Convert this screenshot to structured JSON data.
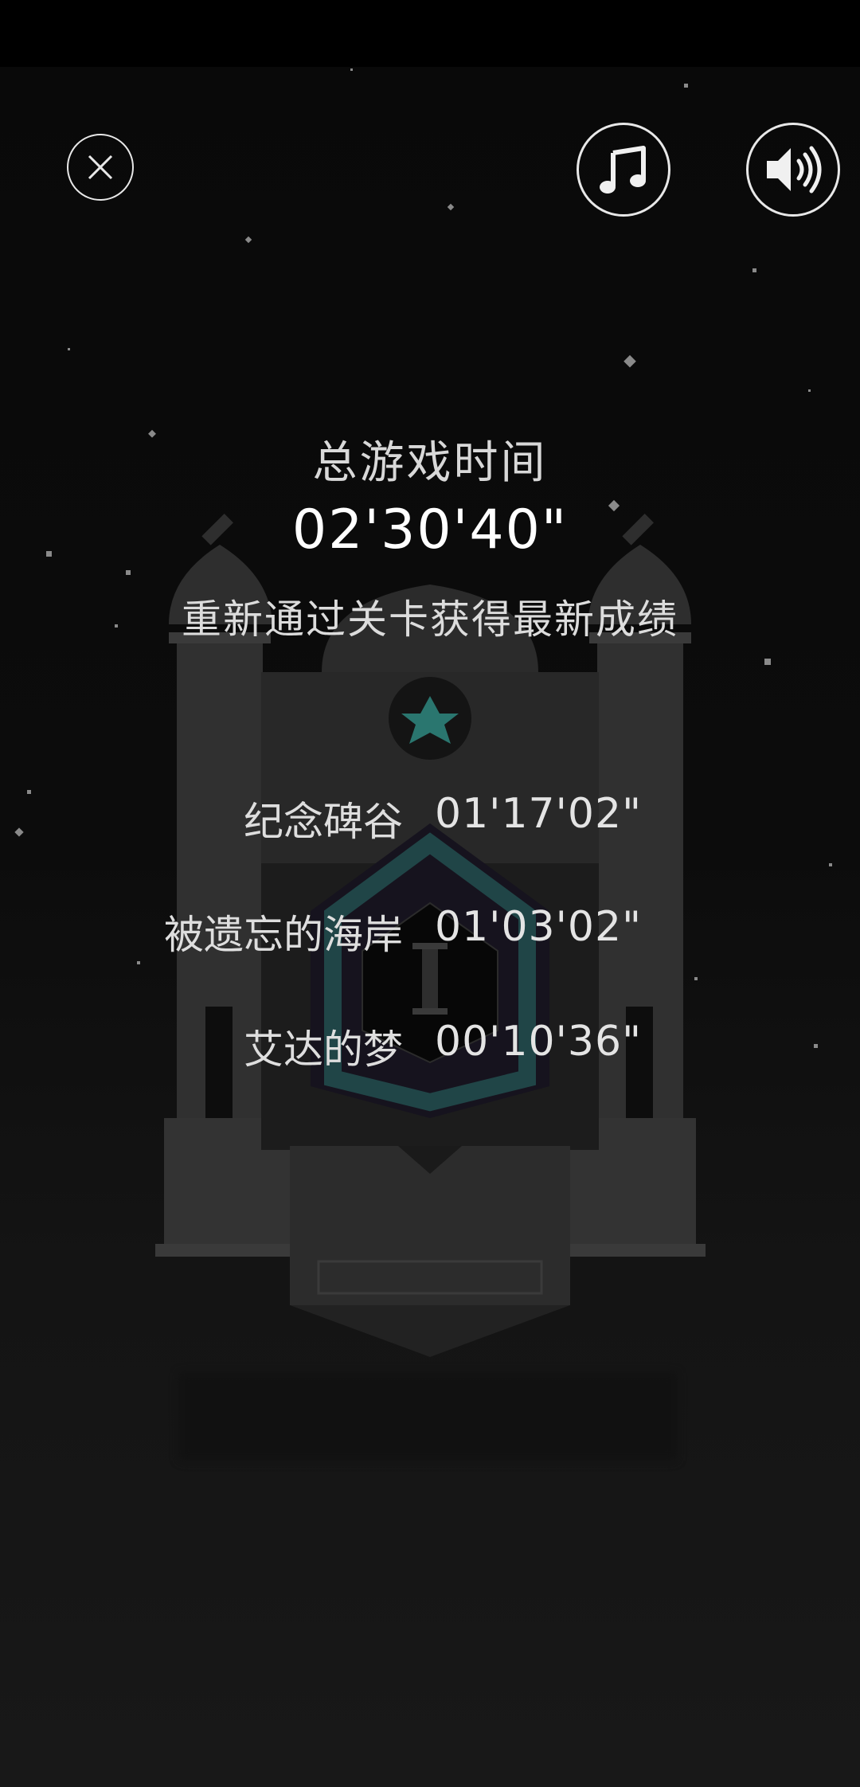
{
  "toolbar": {
    "close_icon": "close-icon",
    "music_icon": "music-note-icon",
    "sound_icon": "speaker-volume-icon"
  },
  "summary": {
    "total_label": "总游戏时间",
    "total_time": "02'30'40\"",
    "replay_hint": "重新通过关卡获得最新成绩"
  },
  "levels": [
    {
      "name": "纪念碑谷",
      "time": "01'17'02\""
    },
    {
      "name": "被遗忘的海岸",
      "time": "01'03'02\""
    },
    {
      "name": "艾达的梦",
      "time": "00'10'36\""
    }
  ],
  "colors": {
    "background": "#0a0a0a",
    "monument": "#2e2e2e",
    "accent_teal": "#2f8f86"
  }
}
